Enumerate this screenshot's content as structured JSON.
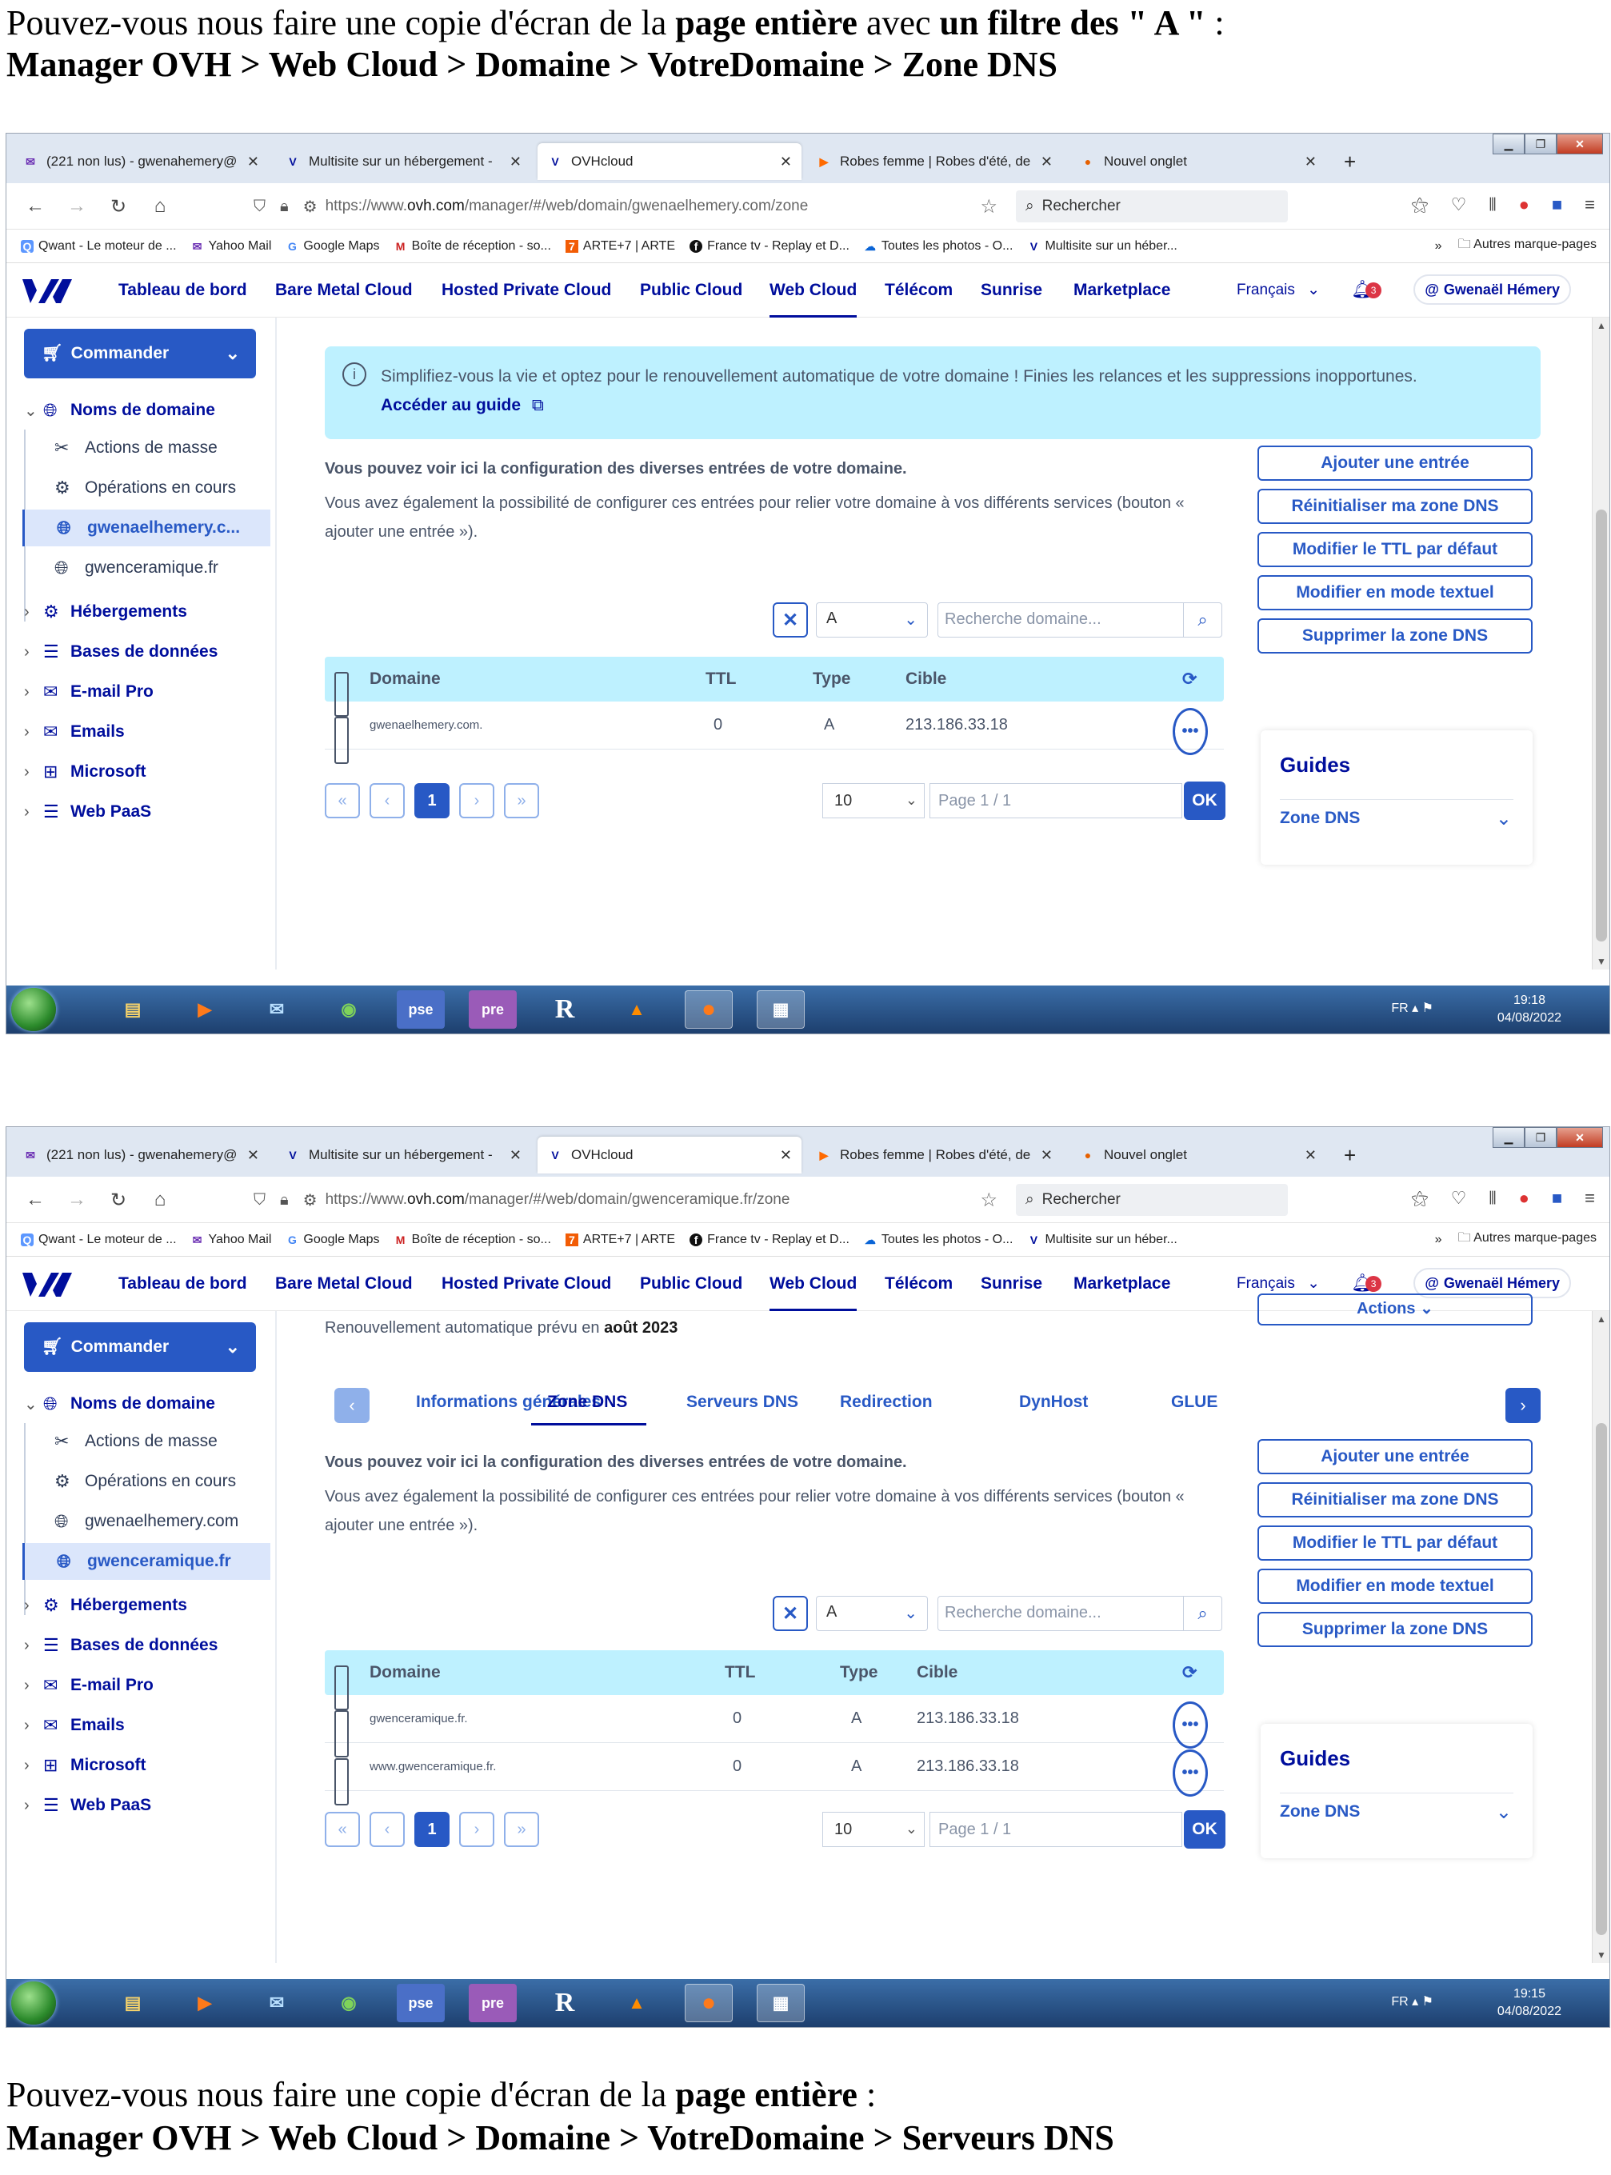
{
  "doc": {
    "top_line1_a": "Pouvez-vous nous faire une copie d'écran de la ",
    "top_line1_b": "page entière",
    "top_line1_c": " avec ",
    "top_line1_d": "un filtre des \" A \"",
    "top_line1_e": " :",
    "top_line2": "Manager OVH > Web Cloud > Domaine > VotreDomaine > Zone DNS",
    "bottom_line1_a": "Pouvez-vous nous faire une copie d'écran de la ",
    "bottom_line1_b": "page entière",
    "bottom_line1_c": " :",
    "bottom_line2": "Manager OVH > Web Cloud > Domaine > VotreDomaine > Serveurs DNS"
  },
  "browser": {
    "tabs": [
      "(221 non lus) - gwenahemery@",
      "Multisite sur un hébergement -",
      "OVHcloud",
      "Robes femme | Robes d'été, de",
      "Nouvel onglet"
    ],
    "search_placeholder": "Rechercher",
    "bookmarks": [
      "Qwant - Le moteur de ...",
      "Yahoo Mail",
      "Google Maps",
      "Boîte de réception - so...",
      "ARTE+7 | ARTE",
      "France tv - Replay et D...",
      "Toutes les photos - O...",
      "Multisite sur un héber..."
    ],
    "other_bookmarks": "Autres marque-pages"
  },
  "ovh": {
    "nav": [
      "Tableau de bord",
      "Bare Metal Cloud",
      "Hosted Private Cloud",
      "Public Cloud",
      "Web Cloud",
      "Télécom",
      "Sunrise",
      "Marketplace"
    ],
    "language": "Français",
    "notif_count": "3",
    "user": "Gwenaël Hémery",
    "commander": "Commander",
    "domains_title": "Noms de domaine",
    "sub_actions": "Actions de masse",
    "sub_ops": "Opérations en cours",
    "side_other": [
      "Hébergements",
      "Bases de données",
      "E-mail Pro",
      "Emails",
      "Microsoft",
      "Web PaaS"
    ],
    "desc_bold": "Vous pouvez voir ici la configuration des diverses entrées de votre domaine.",
    "desc_text": "Vous avez également la possibilité de configurer ces entrées pour relier votre domaine à vos différents services (bouton « ajouter une entrée »).",
    "actions": [
      "Ajouter une entrée",
      "Réinitialiser ma zone DNS",
      "Modifier le TTL par défaut",
      "Modifier en mode textuel",
      "Supprimer la zone DNS"
    ],
    "filter_value": "A",
    "search_placeholder": "Recherche domaine...",
    "cols": [
      "Domaine",
      "TTL",
      "Type",
      "Cible"
    ],
    "pager_size": "10",
    "pager_page": "Page 1 / 1",
    "pager_current": "1",
    "ok": "OK",
    "guides_title": "Guides",
    "guides_link": "Zone DNS",
    "tray_lang": "FR",
    "date": "04/08/2022"
  },
  "shot1": {
    "url_pre": "https://www.",
    "url_host": "ovh.com",
    "url_post": "/manager/#/web/domain/gwenaelhemery.com/zone",
    "domain1": "gwenaelhemery.c...",
    "domain2": "gwenceramique.fr",
    "info_text": "Simplifiez-vous la vie et optez pour le renouvellement automatique de votre domaine ! Finies les relances et les suppressions inopportunes.",
    "info_link": "Accéder au guide",
    "rows": [
      {
        "domain": "gwenaelhemery.com.",
        "ttl": "0",
        "type": "A",
        "target": "213.186.33.18"
      }
    ],
    "time": "19:18"
  },
  "shot2": {
    "url_pre": "https://www.",
    "url_host": "ovh.com",
    "url_post": "/manager/#/web/domain/gwenceramique.fr/zone",
    "domain1": "gwenaelhemery.com",
    "domain2": "gwenceramique.fr",
    "renew_text": "Renouvellement automatique prévu en ",
    "renew_date": "août 2023",
    "actions_label": "Actions",
    "tabs": [
      "Informations générales",
      "Zone DNS",
      "Serveurs DNS",
      "Redirection",
      "DynHost",
      "GLUE"
    ],
    "rows": [
      {
        "domain": "gwenceramique.fr.",
        "ttl": "0",
        "type": "A",
        "target": "213.186.33.18"
      },
      {
        "domain": "www.gwenceramique.fr.",
        "ttl": "0",
        "type": "A",
        "target": "213.186.33.18"
      }
    ],
    "time": "19:15"
  }
}
